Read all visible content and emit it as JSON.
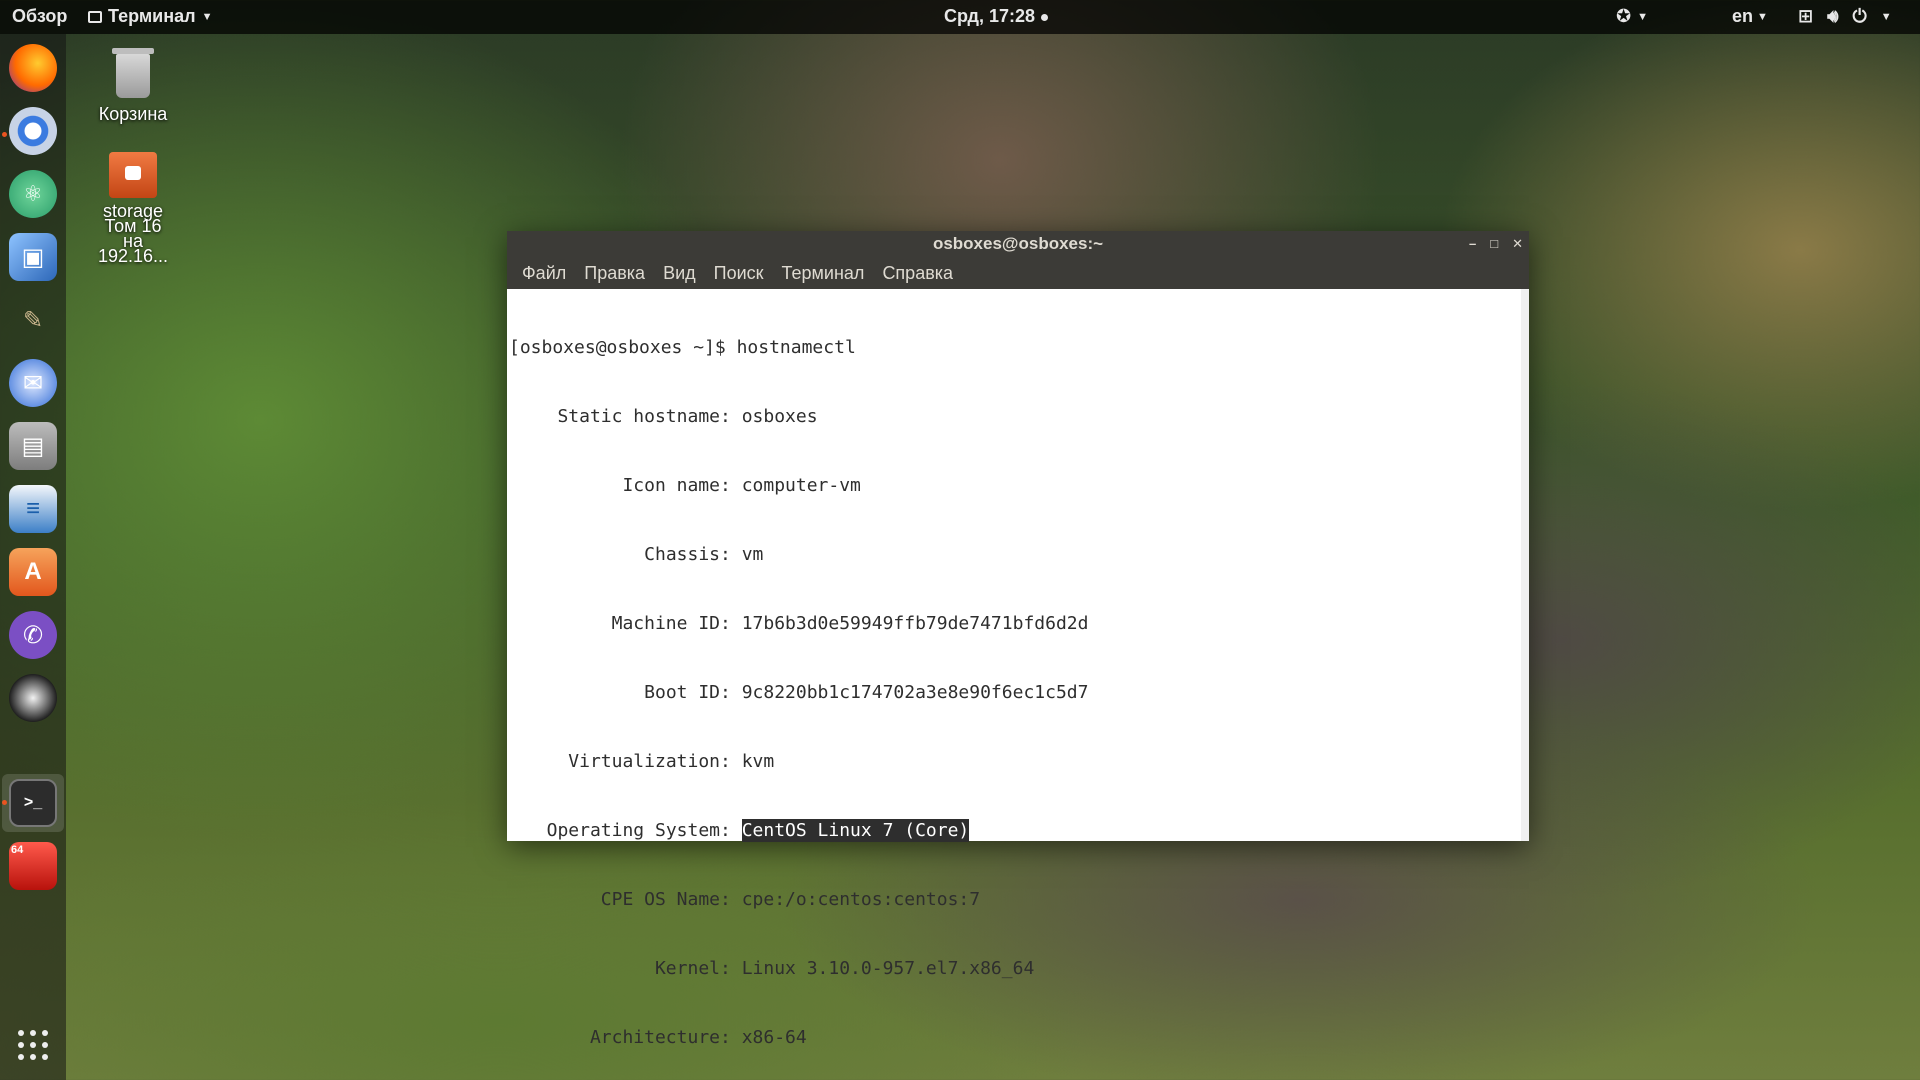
{
  "topbar": {
    "activities": "Обзор",
    "app_menu": "Терминал",
    "clock": "Срд, 17:28",
    "language": "en"
  },
  "desktop": {
    "trash_label": "Корзина",
    "share_label_1": "storage",
    "share_label_2": "Том 16",
    "share_label_3": "на",
    "share_label_4": "192.16..."
  },
  "dock": {
    "items": [
      "firefox-icon",
      "chromium-icon",
      "atom-icon",
      "virtualbox-icon",
      "gimp-icon",
      "thunderbird-icon",
      "files-icon",
      "writer-icon",
      "software-center-icon",
      "viber-icon",
      "inkscape-icon",
      "terminal-icon",
      "app-64-icon"
    ]
  },
  "terminal": {
    "title": "osboxes@osboxes:~",
    "menu": [
      "Файл",
      "Правка",
      "Вид",
      "Поиск",
      "Терминал",
      "Справка"
    ],
    "prompt": "[osboxes@osboxes ~]$ ",
    "command": "hostnamectl",
    "rows": [
      {
        "key": "Static hostname",
        "value": "osboxes"
      },
      {
        "key": "Icon name",
        "value": "computer-vm"
      },
      {
        "key": "Chassis",
        "value": "vm"
      },
      {
        "key": "Machine ID",
        "value": "17b6b3d0e59949ffb79de7471bfd6d2d"
      },
      {
        "key": "Boot ID",
        "value": "9c8220bb1c174702a3e8e90f6ec1c5d7"
      },
      {
        "key": "Virtualization",
        "value": "kvm"
      },
      {
        "key": "Operating System",
        "value": "CentOS Linux 7 (Core)"
      },
      {
        "key": "CPE OS Name",
        "value": "cpe:/o:centos:centos:7"
      },
      {
        "key": "Kernel",
        "value": "Linux 3.10.0-957.el7.x86_64"
      },
      {
        "key": "Architecture",
        "value": "x86-64"
      }
    ]
  }
}
